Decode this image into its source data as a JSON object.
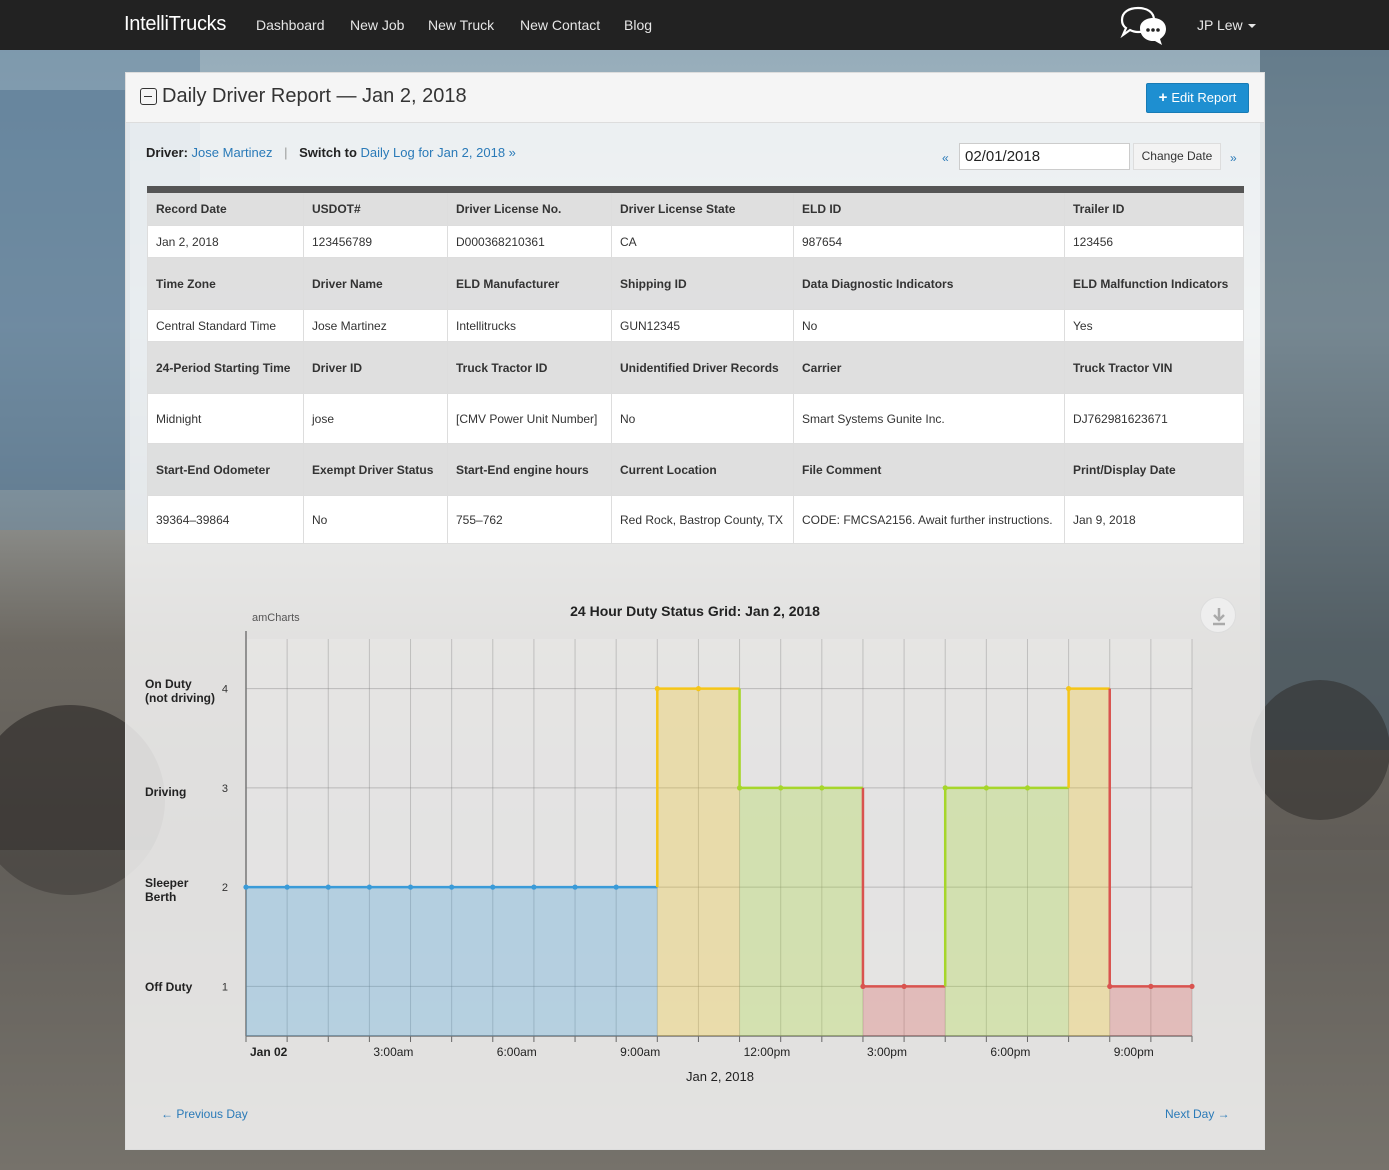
{
  "navbar": {
    "brand": "IntelliTrucks",
    "links": [
      "Dashboard",
      "New Job",
      "New Truck",
      "New Contact",
      "Blog"
    ],
    "user": "JP Lew"
  },
  "header": {
    "title": "Daily Driver Report — Jan 2, 2018",
    "edit_label": "Edit Report"
  },
  "driver_line": {
    "driver_label": "Driver:",
    "driver_name": "Jose Martinez",
    "sep": "|",
    "switch_label": "Switch to",
    "switch_link": "Daily Log for Jan 2, 2018 »"
  },
  "date_nav": {
    "prev": "«",
    "value": "02/01/2018",
    "change_label": "Change Date",
    "next": "»"
  },
  "record": {
    "h1": [
      "Record Date",
      "USDOT#",
      "Driver License No.",
      "Driver License State",
      "ELD ID",
      "Trailer ID"
    ],
    "v1": [
      "Jan 2, 2018",
      "123456789",
      "D000368210361",
      "CA",
      "987654",
      "123456"
    ],
    "h2": [
      "Time Zone",
      "Driver Name",
      "ELD Manufacturer",
      "Shipping ID",
      "Data Diagnostic Indicators",
      "ELD Malfunction Indicators"
    ],
    "v2": [
      "Central Standard Time",
      "Jose Martinez",
      "Intellitrucks",
      "GUN12345",
      "No",
      "Yes"
    ],
    "h3": [
      "24-Period Starting Time",
      "Driver ID",
      "Truck Tractor ID",
      "Unidentified Driver Records",
      "Carrier",
      "Truck Tractor VIN"
    ],
    "v3": [
      "Midnight",
      "jose",
      "[CMV Power Unit Number]",
      "No",
      "Smart Systems Gunite Inc.",
      "DJ762981623671"
    ],
    "h4": [
      "Start-End Odometer",
      "Exempt Driver Status",
      "Start-End engine hours",
      "Current Location",
      "File Comment",
      "Print/Display Date"
    ],
    "v4": [
      "39364–39864",
      "No",
      "755–762",
      "Red Rock, Bastrop County, TX",
      "CODE: FMCSA2156. Await further instructions.",
      "Jan 9, 2018"
    ]
  },
  "colors": {
    "brand_blue": "#1e8fd1",
    "sleeper": "#3a9bd8",
    "on_duty": "#f5c518",
    "driving": "#a6d62a",
    "off_duty": "#d9534f"
  },
  "chart_data": {
    "type": "line",
    "title": "24 Hour Duty Status Grid: Jan 2, 2018",
    "credit": "amCharts",
    "xlabel": "Jan 2, 2018",
    "x_ticks": [
      "Jan 02",
      "3:00am",
      "6:00am",
      "9:00am",
      "12:00pm",
      "3:00pm",
      "6:00pm",
      "9:00pm"
    ],
    "xlim": [
      0,
      23
    ],
    "ylim": [
      0.5,
      4.5
    ],
    "y_ticks": [
      {
        "value": 1,
        "status": "Off Duty"
      },
      {
        "value": 2,
        "status": "Sleeper Berth"
      },
      {
        "value": 3,
        "status": "Driving"
      },
      {
        "value": 4,
        "status": "On Duty (not driving)"
      }
    ],
    "step_line": true,
    "segments": [
      {
        "start": 0,
        "end": 10,
        "value": 2,
        "status": "Sleeper Berth"
      },
      {
        "start": 10,
        "end": 12,
        "value": 4,
        "status": "On Duty (not driving)"
      },
      {
        "start": 12,
        "end": 15,
        "value": 3,
        "status": "Driving"
      },
      {
        "start": 15,
        "end": 17,
        "value": 1,
        "status": "Off Duty"
      },
      {
        "start": 17,
        "end": 20,
        "value": 3,
        "status": "Driving"
      },
      {
        "start": 20,
        "end": 21,
        "value": 4,
        "status": "On Duty (not driving)"
      },
      {
        "start": 21,
        "end": 23,
        "value": 1,
        "status": "Off Duty"
      }
    ]
  },
  "pager": {
    "prev": "← Previous Day",
    "next": "Next Day →"
  }
}
